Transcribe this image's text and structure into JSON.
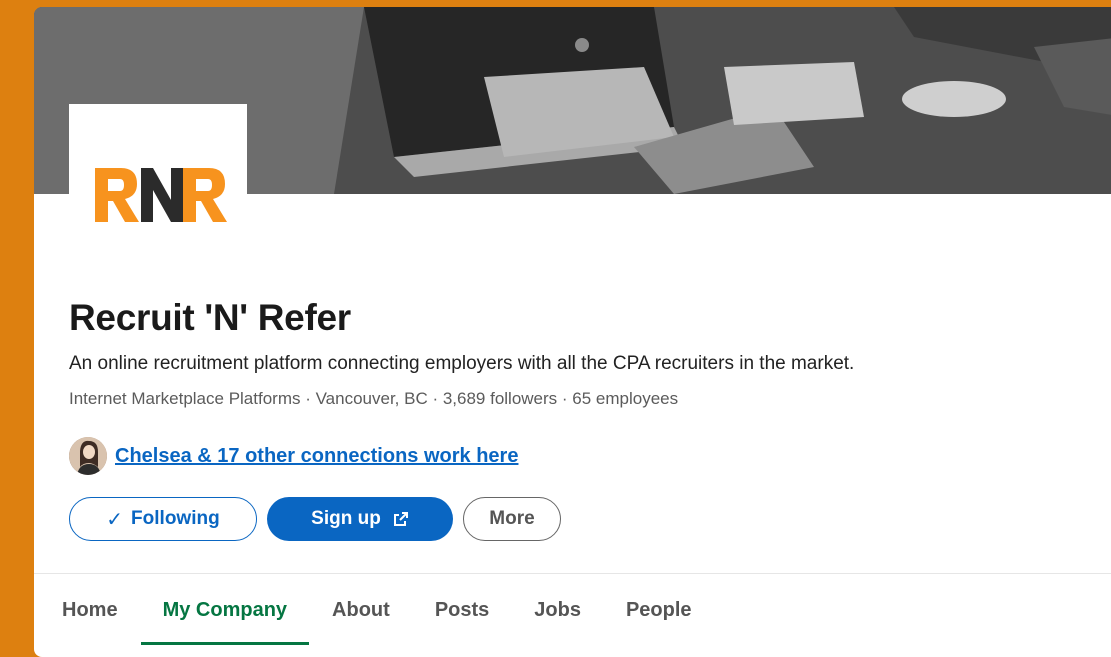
{
  "company": {
    "name": "Recruit 'N' Refer",
    "tagline": "An online recruitment platform connecting employers with all the CPA recruiters in the market.",
    "meta": "Internet Marketplace Platforms · Vancouver, BC · 3,689 followers · 65 employees",
    "logo_text": "RNR"
  },
  "connections": {
    "text": "Chelsea & 17 other connections work here"
  },
  "actions": {
    "following_label": "Following",
    "following_icon": "checkmark-icon",
    "signup_label": "Sign up",
    "signup_icon": "external-link-icon",
    "more_label": "More"
  },
  "tabs": [
    {
      "label": "Home"
    },
    {
      "label": "My Company",
      "active": true
    },
    {
      "label": "About"
    },
    {
      "label": "Posts"
    },
    {
      "label": "Jobs"
    },
    {
      "label": "People"
    }
  ],
  "colors": {
    "page_background": "#dd8010",
    "brand_blue": "#0a66c2",
    "active_tab_green": "#057642",
    "logo_orange": "#f7931e",
    "logo_dark": "#2b2b2b"
  }
}
